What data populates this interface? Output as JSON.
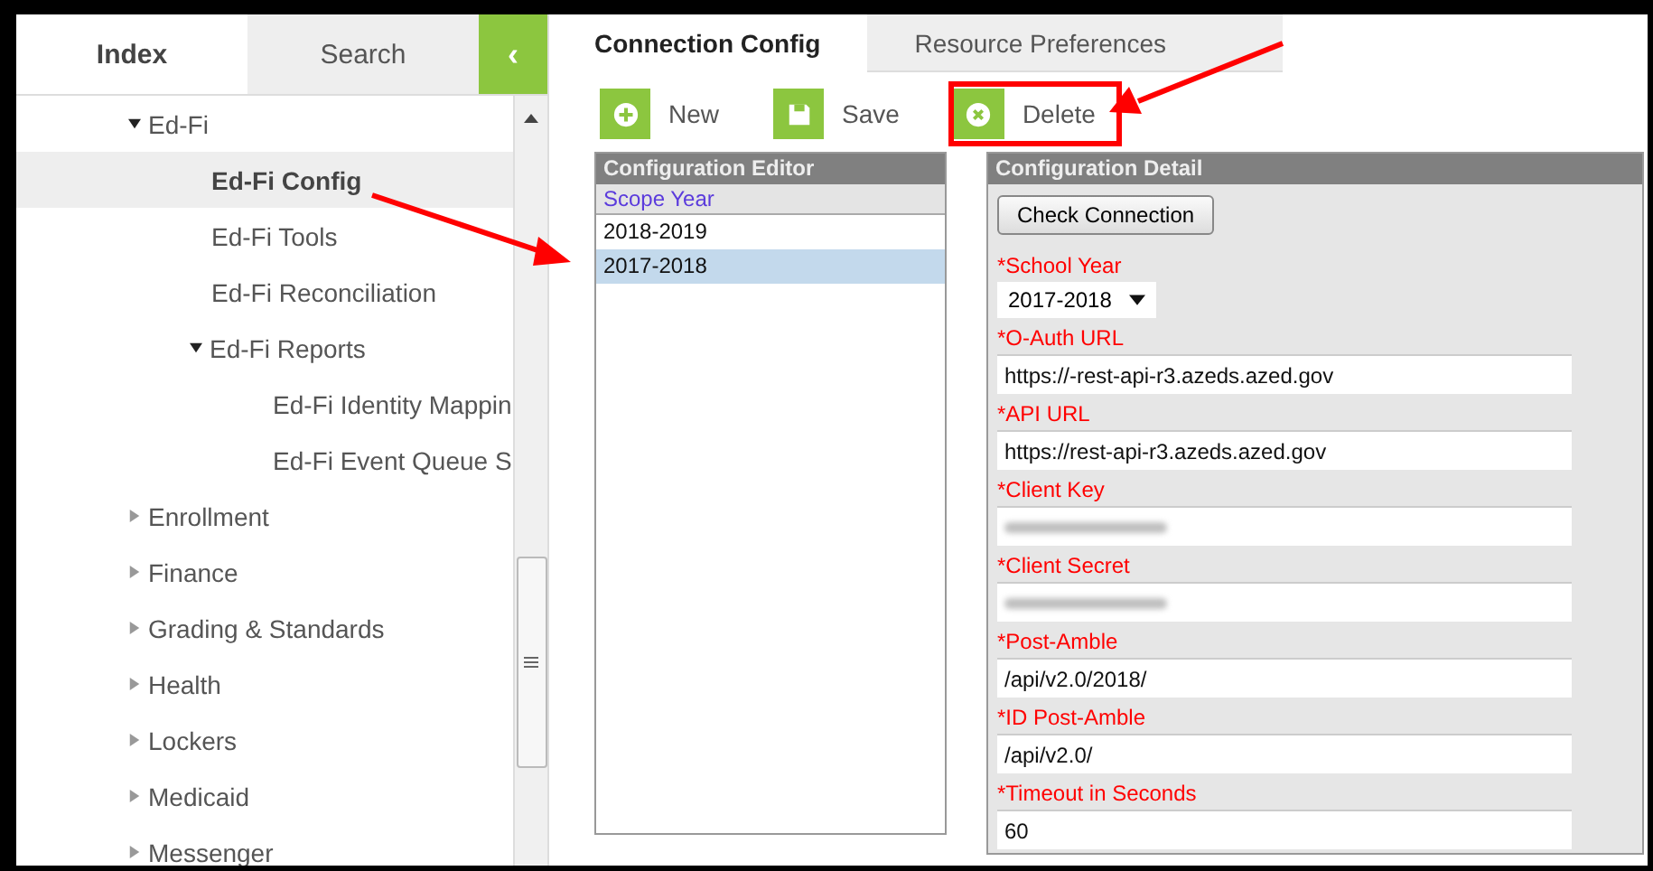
{
  "sidebar": {
    "tabs": [
      {
        "label": "Index",
        "selected": true
      },
      {
        "label": "Search",
        "selected": false
      }
    ],
    "collapse_button": {
      "label": "‹"
    },
    "tree": [
      {
        "label": "Ed-Fi",
        "kind": "folder",
        "expanded": true,
        "selected": false,
        "children": [
          {
            "label": "Ed-Fi Config",
            "kind": "page",
            "selected": true
          },
          {
            "label": "Ed-Fi Tools",
            "kind": "page",
            "selected": false
          },
          {
            "label": "Ed-Fi Reconciliation",
            "kind": "page",
            "selected": false
          },
          {
            "label": "Ed-Fi Reports",
            "kind": "folder",
            "expanded": true,
            "selected": false,
            "children": [
              {
                "label": "Ed-Fi Identity Mappin",
                "kind": "page",
                "selected": false
              },
              {
                "label": "Ed-Fi Event Queue S",
                "kind": "page",
                "selected": false
              }
            ]
          }
        ]
      },
      {
        "label": "Enrollment",
        "kind": "folder",
        "expanded": false,
        "selected": false
      },
      {
        "label": "Finance",
        "kind": "folder",
        "expanded": false,
        "selected": false
      },
      {
        "label": "Grading & Standards",
        "kind": "folder",
        "expanded": false,
        "selected": false
      },
      {
        "label": "Health",
        "kind": "folder",
        "expanded": false,
        "selected": false
      },
      {
        "label": "Lockers",
        "kind": "folder",
        "expanded": false,
        "selected": false
      },
      {
        "label": "Medicaid",
        "kind": "folder",
        "expanded": false,
        "selected": false
      },
      {
        "label": "Messenger",
        "kind": "folder",
        "expanded": false,
        "selected": false
      }
    ]
  },
  "tabs": [
    {
      "label": "Connection Config",
      "selected": true
    },
    {
      "label": "Resource Preferences",
      "selected": false
    }
  ],
  "toolbar": [
    {
      "label": "New",
      "kind": "new",
      "highlighted": false
    },
    {
      "label": "Save",
      "kind": "save",
      "highlighted": false
    },
    {
      "label": "Delete",
      "kind": "delete",
      "highlighted": true
    }
  ],
  "editor": {
    "title": "Configuration Editor",
    "column": "Scope Year",
    "rows": [
      {
        "value": "2018-2019",
        "selected": false
      },
      {
        "value": "2017-2018",
        "selected": true
      }
    ]
  },
  "detail": {
    "title": "Configuration Detail",
    "check_button": "Check Connection",
    "fields": [
      {
        "label": "*School Year",
        "kind": "select",
        "value": "2017-2018"
      },
      {
        "label": "*O-Auth URL",
        "kind": "text",
        "value": "https://-rest-api-r3.azeds.azed.gov"
      },
      {
        "label": "*API URL",
        "kind": "text",
        "value": "https://rest-api-r3.azeds.azed.gov"
      },
      {
        "label": "*Client Key",
        "kind": "blurred"
      },
      {
        "label": "*Client Secret",
        "kind": "blurred"
      },
      {
        "label": "*Post-Amble",
        "kind": "text",
        "value": "/api/v2.0/2018/"
      },
      {
        "label": "*ID Post-Amble",
        "kind": "text",
        "value": "/api/v2.0/"
      },
      {
        "label": "*Timeout in Seconds",
        "kind": "text",
        "value": "60"
      }
    ]
  }
}
